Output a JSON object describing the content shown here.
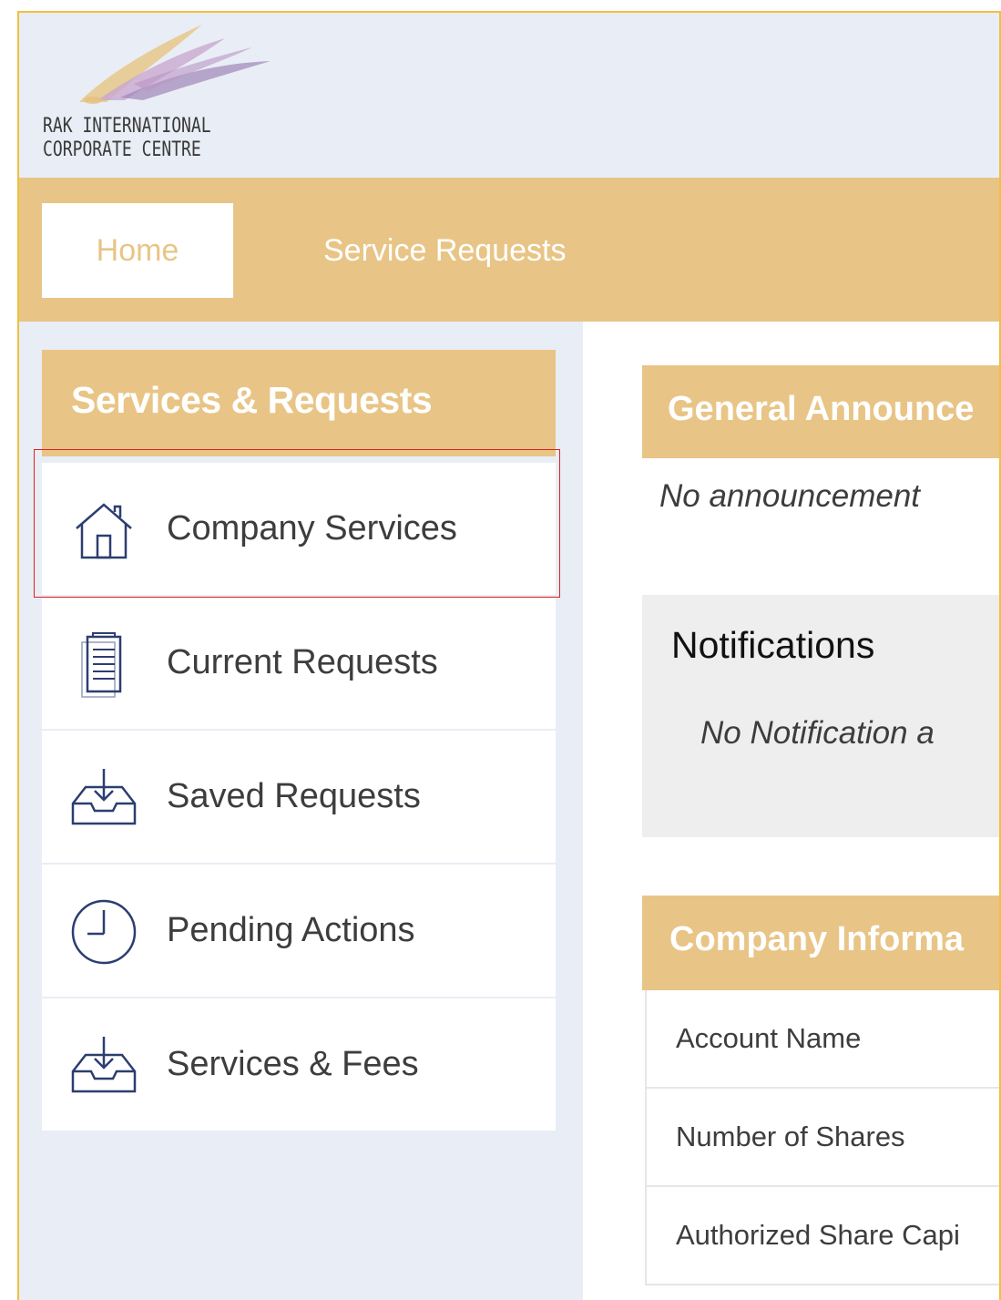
{
  "brand": {
    "line1": "RAK INTERNATIONAL",
    "line2": "CORPORATE CENTRE",
    "logo_colors": [
      "#c9a7cf",
      "#e6c17a",
      "#9f86b8"
    ]
  },
  "nav": {
    "tabs": [
      {
        "label": "Home",
        "active": true
      },
      {
        "label": "Service Requests",
        "active": false
      }
    ]
  },
  "sidebar": {
    "title": "Services & Requests",
    "items": [
      {
        "label": "Company Services",
        "icon": "home-icon",
        "highlighted": true
      },
      {
        "label": "Current Requests",
        "icon": "clipboard-icon"
      },
      {
        "label": "Saved Requests",
        "icon": "inbox-download-icon"
      },
      {
        "label": "Pending Actions",
        "icon": "clock-icon"
      },
      {
        "label": "Services & Fees",
        "icon": "inbox-download-icon"
      }
    ]
  },
  "announcements": {
    "title": "General Announce",
    "empty_text": "No announcement"
  },
  "notifications": {
    "title": "Notifications",
    "empty_text": "No Notification a"
  },
  "company_info": {
    "title": "Company Informa",
    "rows": [
      "Account Name",
      "Number of Shares",
      "Authorized Share Capi"
    ]
  },
  "colors": {
    "accent": "#e8c586",
    "sidebar_bg": "#e9edf5",
    "highlight_border": "#e02020",
    "frame_border": "#f0c040"
  }
}
